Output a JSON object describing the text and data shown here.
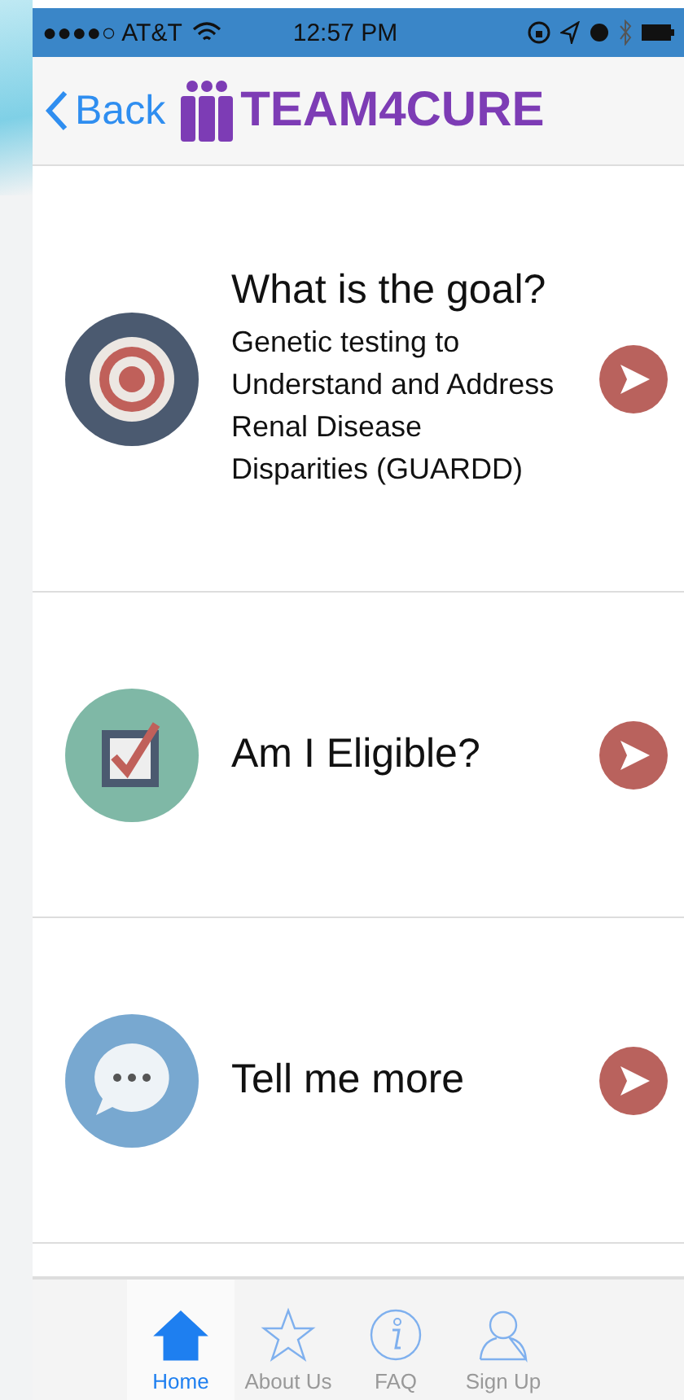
{
  "status_bar": {
    "carrier": "●●●●○ AT&T",
    "time": "12:57 PM"
  },
  "nav_bar": {
    "back": "Back",
    "brand": "TEAM4CURE"
  },
  "menu": [
    {
      "kind": "target",
      "title": "What is the goal?",
      "subtitle": "Genetic testing to Understand and Address Renal Disease Disparities (GUARDD)"
    },
    {
      "kind": "checkbox",
      "title": "Am I Eligible?"
    },
    {
      "kind": "chat",
      "title": "Tell me more"
    }
  ],
  "tabs": [
    {
      "kind": "home",
      "label": "Home",
      "selected": true
    },
    {
      "kind": "star",
      "label": "About Us",
      "selected": false
    },
    {
      "kind": "info",
      "label": "FAQ",
      "selected": false
    },
    {
      "kind": "person",
      "label": "Sign Up",
      "selected": false
    }
  ]
}
